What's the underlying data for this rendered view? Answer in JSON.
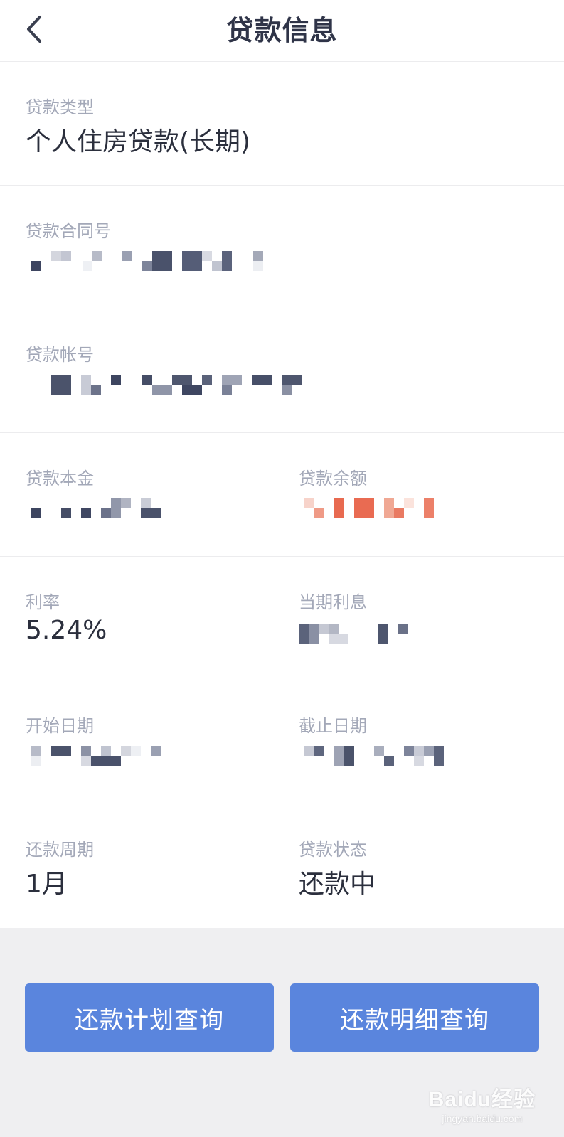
{
  "header": {
    "title": "贷款信息",
    "back_icon": "chevron-left-icon"
  },
  "fields": {
    "loan_type": {
      "label": "贷款类型",
      "value": "个人住房贷款(长期)"
    },
    "contract_no": {
      "label": "贷款合同号"
    },
    "account_no": {
      "label": "贷款帐号"
    },
    "principal": {
      "label": "贷款本金"
    },
    "balance": {
      "label": "贷款余额"
    },
    "rate": {
      "label": "利率",
      "value": "5.24%"
    },
    "interest": {
      "label": "当期利息"
    },
    "start_date": {
      "label": "开始日期"
    },
    "end_date": {
      "label": "截止日期"
    },
    "period": {
      "label": "还款周期",
      "value": "1月"
    },
    "status": {
      "label": "贷款状态",
      "value": "还款中"
    }
  },
  "buttons": {
    "plan_query": "还款计划查询",
    "detail_query": "还款明细查询"
  },
  "watermark": {
    "brand": "Baidu经验",
    "url": "jingyan.baidu.com"
  },
  "colors": {
    "accent": "#5a85dd",
    "masked_balance": "#e86a50"
  }
}
